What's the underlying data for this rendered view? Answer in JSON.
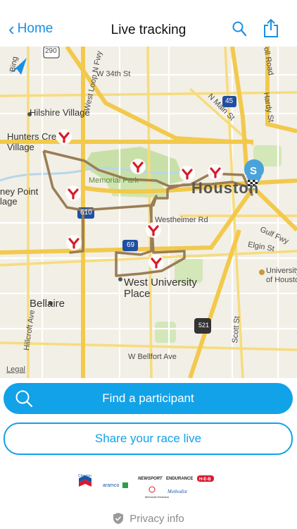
{
  "nav": {
    "back_label": "Home",
    "title": "Live tracking",
    "search_icon": "search-icon",
    "share_icon": "share-icon"
  },
  "map": {
    "labels": {
      "hwy290": "290",
      "w34": "W 34th St",
      "hilshire": "Hilshire Village",
      "hunters1": "Hunters Cre",
      "hunters2": "Village",
      "westloop": "West Loop N Fwy",
      "nmain": "N Main St",
      "hardy": "Hardy St",
      "tollroad": "Toll Road",
      "i45": "45",
      "memorial": "Memorial Park",
      "houston": "Houston",
      "piney1": "ney Point",
      "piney2": "lage",
      "i610": "610",
      "westheimer": "Westheimer Rd",
      "gulffwy": "Gulf Fwy",
      "elgin": "Elgin St",
      "i69": "69",
      "wup1": "West University",
      "wup2": "Place",
      "uh1": "University",
      "uh2": "of Housto",
      "bellaire": "Bellaire",
      "hillcroft": "Hillcroft Ave",
      "bellfort": "W Bellfort Ave",
      "scott": "Scott St",
      "hwy521": "521",
      "legal": "Legal",
      "bing": "Bing"
    },
    "start_marker": "S",
    "checkpoints_count": 8
  },
  "actions": {
    "find_label": "Find a participant",
    "share_label": "Share your race live"
  },
  "sponsors": {
    "chevron": "Chevron",
    "aramco": "aramco",
    "newsport": "NEWSPORT",
    "endurance": "ENDURANCE",
    "heb": "H-E-B",
    "methodist": "Methodist",
    "memorial": "Memorial Hermann"
  },
  "footer": {
    "privacy_label": "Privacy info"
  },
  "colors": {
    "accent": "#12a2e8",
    "route": "#9a7d55",
    "checkpoint": "#d8192b",
    "highway": "#f2c94c",
    "park": "#c8e0a8"
  }
}
